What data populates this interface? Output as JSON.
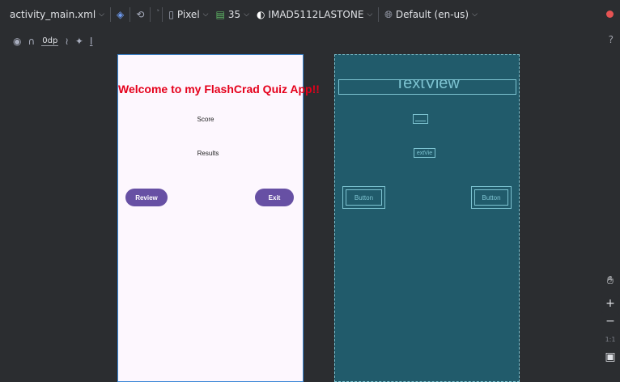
{
  "toolbar": {
    "file_name": "activity_main.xml",
    "device": "Pixel",
    "api_level": "35",
    "theme": "IMAD5112LASTONE",
    "locale": "Default (en-us)",
    "margin_value": "0dp",
    "help": "?"
  },
  "design": {
    "welcome_text": "Welcome to my FlashCrad Quiz App!!",
    "score_text": "Score",
    "results_text": "Results",
    "review_button": "Review",
    "exit_button": "Exit"
  },
  "blueprint": {
    "title_text": "TextView",
    "small_text": "extVie",
    "left_button": "Button",
    "right_button": "Button"
  },
  "zoom": {
    "plus": "+",
    "minus": "−",
    "one_to_one": "1:1"
  },
  "colors": {
    "welcome_red": "#e5001b",
    "button_purple": "#6750a4",
    "blueprint_bg": "#215b6b",
    "phone_bg": "#fdf7fe"
  }
}
